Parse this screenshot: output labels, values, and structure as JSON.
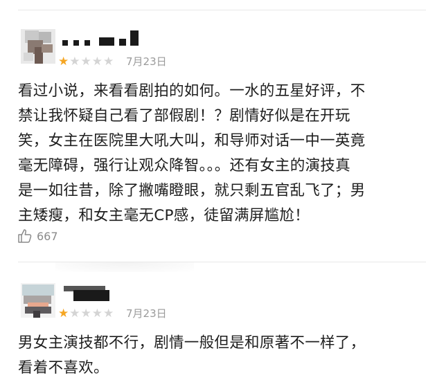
{
  "reviews": [
    {
      "stars_filled": 1,
      "stars_total": 5,
      "date": "7月23日",
      "lines": [
        "看过小说，来看看剧拍的如何。一水的五星好评，不",
        "禁让我怀疑自己看了部假剧！？剧情好似是在开玩",
        "笑，女主在医院里大吼大叫，和导师对话一中一英竟",
        "毫无障碍，强行让观众降智。。。还有女主的演技真",
        "是一如往昔，除了撇嘴瞪眼，就只剩五官乱飞了；男",
        "主矮瘦，和女主毫无CP感，徒留满屏尴尬！"
      ],
      "likes": "667"
    },
    {
      "stars_filled": 1,
      "stars_total": 5,
      "date": "7月23日",
      "lines": [
        "男女主演技都不行，剧情一般但是和原著不一样了，",
        "看着不喜欢。"
      ]
    }
  ],
  "colors": {
    "star_on": "#f5a623",
    "star_off": "#d4d4d4",
    "meta": "#9a9a9a"
  },
  "icons": {
    "like": "thumbs-up-icon",
    "star": "star-icon"
  }
}
